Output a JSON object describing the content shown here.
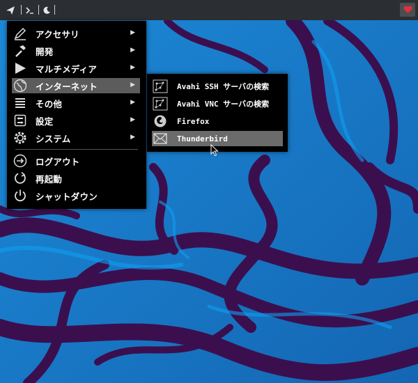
{
  "topbar": {
    "launcher_icon": "paper-plane-icon",
    "terminal_icon": "terminal-icon",
    "moon_icon": "moon-icon",
    "tray_icon": "heart-icon",
    "tray_color": "#e0313a"
  },
  "main_menu": {
    "items": [
      {
        "label": "アクセサリ",
        "icon": "pen-icon",
        "has_submenu": true
      },
      {
        "label": "開発",
        "icon": "hammer-icon",
        "has_submenu": true
      },
      {
        "label": "マルチメディア",
        "icon": "play-icon",
        "has_submenu": true
      },
      {
        "label": "インターネット",
        "icon": "globe-icon",
        "has_submenu": true,
        "highlighted": true
      },
      {
        "label": "その他",
        "icon": "list-icon",
        "has_submenu": true
      },
      {
        "label": "設定",
        "icon": "settings-icon",
        "has_submenu": true
      },
      {
        "label": "システム",
        "icon": "gear-icon",
        "has_submenu": true
      }
    ],
    "session": [
      {
        "label": "ログアウト",
        "icon": "logout-icon"
      },
      {
        "label": "再起動",
        "icon": "restart-icon"
      },
      {
        "label": "シャットダウン",
        "icon": "power-icon"
      }
    ]
  },
  "sub_menu": {
    "items": [
      {
        "label": "Avahi SSH サーバの検索",
        "icon": "network-icon"
      },
      {
        "label": "Avahi VNC サーバの検索",
        "icon": "network-icon"
      },
      {
        "label": "Firefox",
        "icon": "firefox-icon"
      },
      {
        "label": "Thunderbird",
        "icon": "mail-icon",
        "highlighted": true
      }
    ]
  },
  "colors": {
    "menu_bg": "#000000",
    "highlight": "#5c5c5c",
    "topbar_bg": "#2b2e33",
    "wallpaper_blue": "#1a6fc0",
    "wallpaper_purple": "#3b0f4e"
  }
}
